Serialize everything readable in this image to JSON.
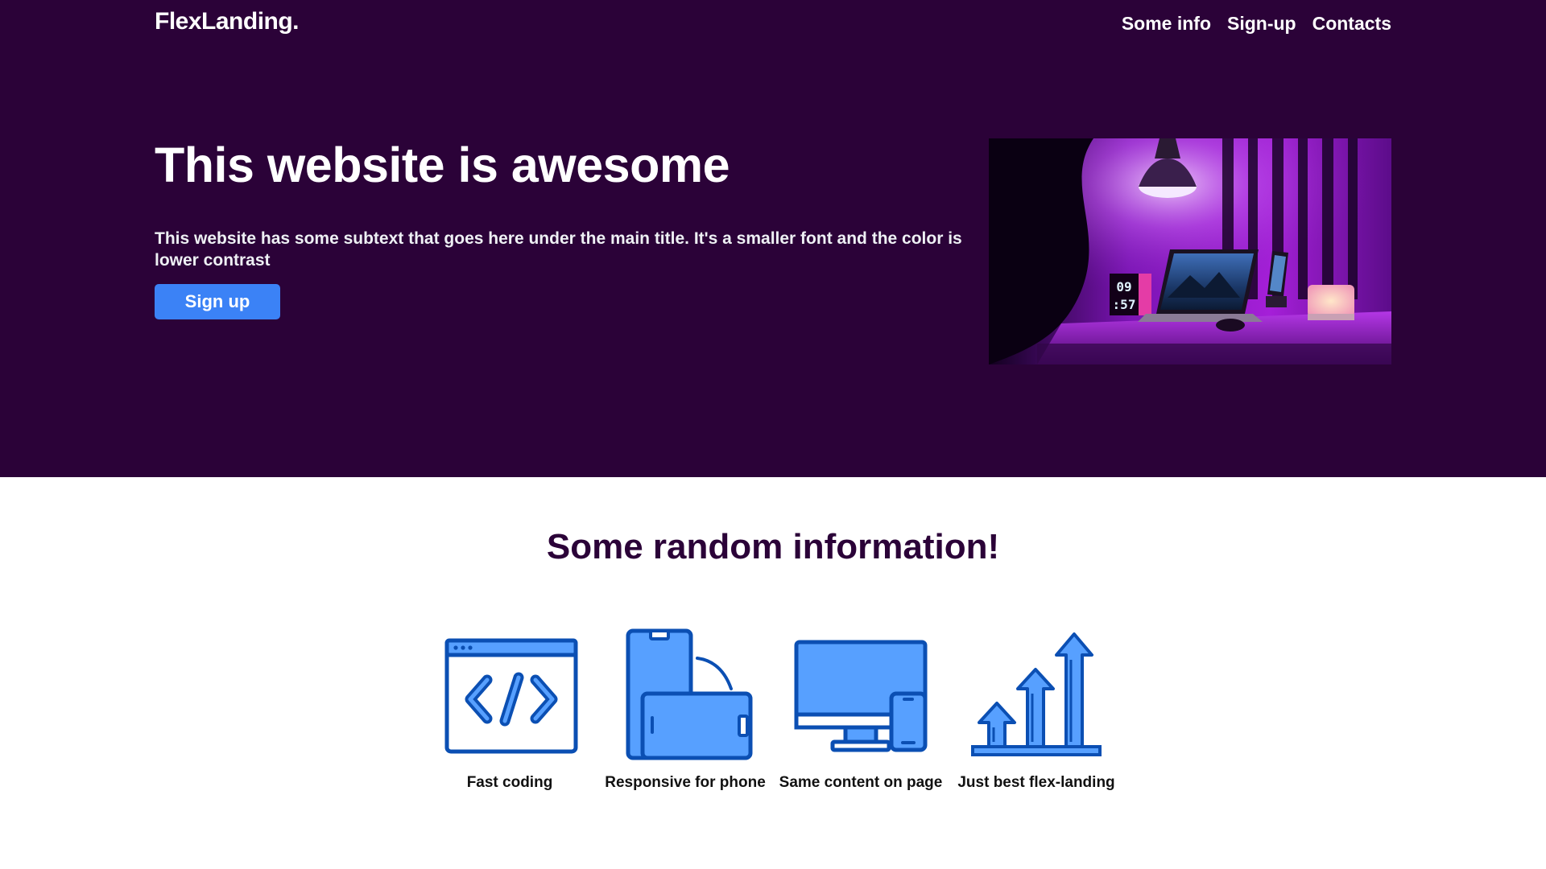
{
  "header": {
    "brand": "FlexLanding.",
    "nav": [
      {
        "label": "Some info"
      },
      {
        "label": "Sign-up"
      },
      {
        "label": "Contacts"
      }
    ]
  },
  "hero": {
    "title": "This website is awesome",
    "subtitle": "This website has some subtext that goes here under the main title. It's a smaller font and the color is lower contrast",
    "button_label": "Sign up",
    "image_icon": "desk-setup-photo",
    "clock_top": "09",
    "clock_bottom": ":57"
  },
  "info": {
    "title": "Some random information!",
    "features": [
      {
        "label": "Fast coding",
        "icon": "code-window-icon"
      },
      {
        "label": "Responsive for phone",
        "icon": "phone-rotate-icon"
      },
      {
        "label": "Same content on page",
        "icon": "monitor-phone-icon"
      },
      {
        "label": "Just best flex-landing",
        "icon": "growth-arrows-icon"
      }
    ]
  },
  "colors": {
    "hero_bg": "#2b0238",
    "accent": "#3b82f6",
    "icon_fill": "#57a0ff",
    "icon_stroke": "#0b4fb3",
    "info_title": "#2b0238"
  }
}
